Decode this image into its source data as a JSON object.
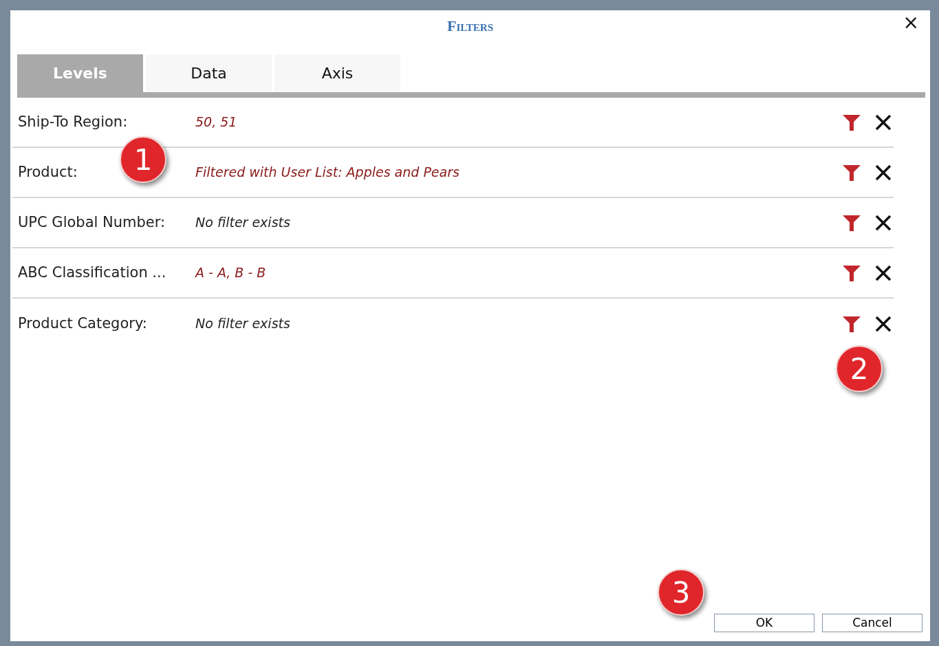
{
  "window": {
    "title": "Filters",
    "close": "×"
  },
  "tabs": [
    {
      "label": "Levels",
      "selected": true
    },
    {
      "label": "Data",
      "selected": false
    },
    {
      "label": "Axis",
      "selected": false
    }
  ],
  "filters": [
    {
      "label": "Ship-To Region:",
      "value": "50, 51",
      "filtered": true
    },
    {
      "label": "Product:",
      "value": "Filtered with User List: Apples and Pears",
      "filtered": true
    },
    {
      "label": "UPC Global Number:",
      "value": "No filter exists",
      "filtered": false
    },
    {
      "label": "ABC Classification ...",
      "value": "A - A, B - B",
      "filtered": true
    },
    {
      "label": "Product Category:",
      "value": "No filter exists",
      "filtered": false
    }
  ],
  "buttons": [
    "OK",
    "Cancel"
  ],
  "callouts": [
    {
      "text": "1"
    },
    {
      "text": "2"
    },
    {
      "text": "3"
    }
  ]
}
